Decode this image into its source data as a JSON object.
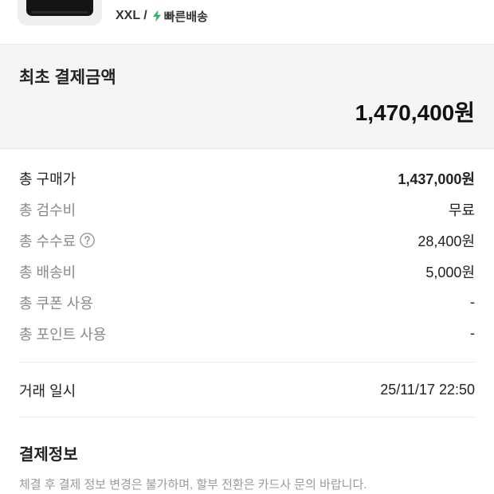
{
  "product": {
    "option_text": "XXL /",
    "shipping_icon": "lightning-icon",
    "shipping_label": "빠른배송"
  },
  "summary": {
    "title": "최초 결제금액",
    "amount": "1,470,400원"
  },
  "cost_rows": [
    {
      "label": "총 구매가",
      "value": "1,437,000원"
    },
    {
      "label": "총 검수비",
      "value": "무료"
    },
    {
      "label": "총 수수료",
      "value": "28,400원",
      "help_icon": "question-circle-icon"
    },
    {
      "label": "총 배송비",
      "value": "5,000원"
    },
    {
      "label": "총 쿠폰 사용",
      "value": "-"
    },
    {
      "label": "총 포인트 사용",
      "value": "-"
    }
  ],
  "transaction": {
    "label": "거래 일시",
    "value": "25/11/17 22:50"
  },
  "payment_info": {
    "title": "결제정보",
    "notice": "체결 후 결제 정보 변경은 불가하며, 할부 전환은 카드사 문의 바랍니다."
  },
  "colors": {
    "accent_green": "#2fb36b",
    "summary_bg": "#f5f5f5",
    "primary_text": "#222222",
    "secondary_text": "#8a8a8a",
    "divider": "#ebebeb"
  }
}
